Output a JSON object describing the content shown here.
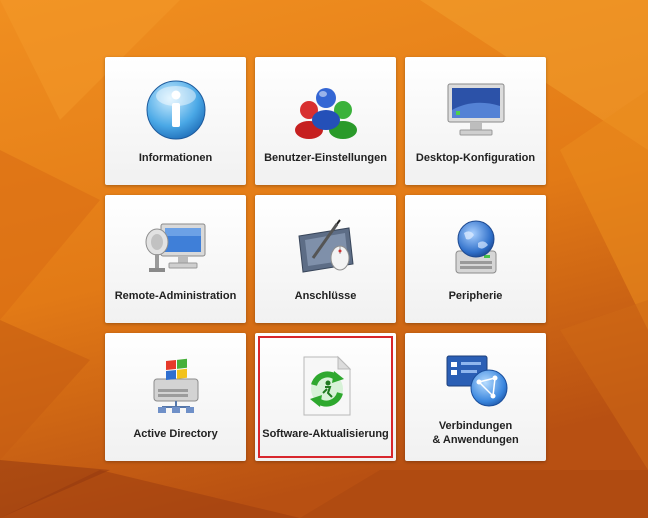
{
  "tiles": [
    {
      "label": "Informationen",
      "icon": "info-icon"
    },
    {
      "label": "Benutzer-Einstellungen",
      "icon": "users-icon"
    },
    {
      "label": "Desktop-Konfiguration",
      "icon": "monitor-icon"
    },
    {
      "label": "Remote-Administration",
      "icon": "remote-admin-icon"
    },
    {
      "label": "Anschlüsse",
      "icon": "tablet-mouse-icon"
    },
    {
      "label": "Peripherie",
      "icon": "globe-device-icon"
    },
    {
      "label": "Active Directory",
      "icon": "active-directory-icon"
    },
    {
      "label": "Software-Aktualisierung",
      "icon": "software-update-icon",
      "selected": true
    },
    {
      "label_line1": "Verbindungen",
      "label_line2": "& Anwendungen",
      "icon": "connections-icon"
    }
  ],
  "colors": {
    "background": "#e8821a",
    "selection_border": "#d8262c",
    "tile": "#f5f5f5"
  }
}
